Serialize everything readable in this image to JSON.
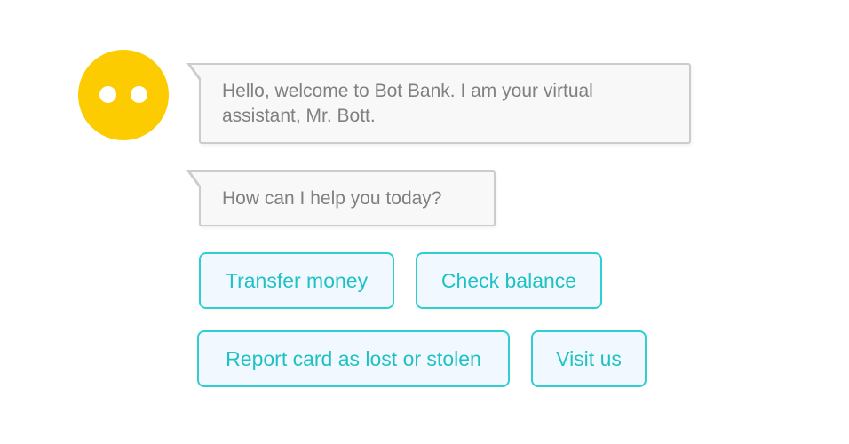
{
  "assistant": {
    "avatar_icon": "robot-face-icon",
    "avatar_color": "#fccc00"
  },
  "messages": [
    {
      "text": "Hello, welcome to Bot Bank. I am your virtual assistant, Mr. Bott."
    },
    {
      "text": "How can I help you today?"
    }
  ],
  "options": [
    {
      "label": "Transfer money"
    },
    {
      "label": "Check balance"
    },
    {
      "label": "Report card as lost or stolen"
    },
    {
      "label": "Visit us"
    }
  ],
  "colors": {
    "option_border": "#2fcfcf",
    "option_text": "#1fc2c4",
    "option_fill": "#f2f8ff",
    "bubble_border": "#cccccc",
    "bubble_text": "#808080"
  }
}
